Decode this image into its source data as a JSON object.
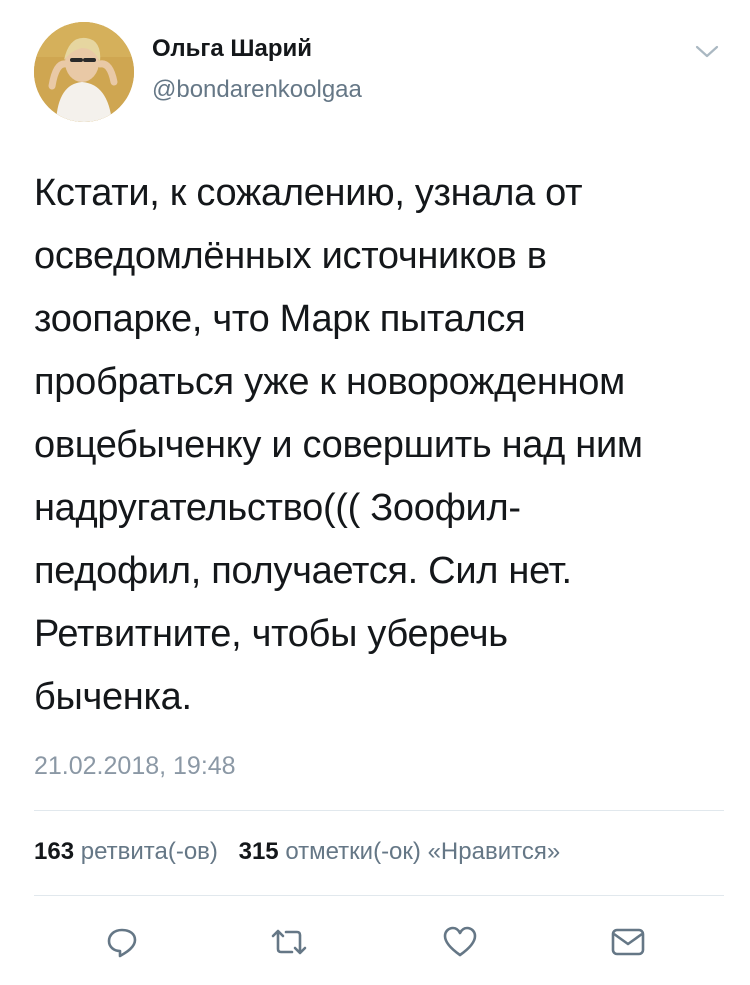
{
  "user": {
    "display_name": "Ольга Шарий",
    "handle": "@bondarenkoolgaa"
  },
  "tweet": {
    "text": "Кстати, к сожалению, узнала от\nосведомлённых источников в\nзоопарке, что Марк пытался\nпробраться уже к новорожденном\nовцебыченку и совершить над ним\nнадругательство((( Зоофил-\nпедофил, получается. Сил нет.\nРетвитните, чтобы уберечь\nбыченка.",
    "timestamp": "21.02.2018, 19:48"
  },
  "stats": {
    "retweets_count": "163",
    "retweets_label": "ретвита(-ов)",
    "likes_count": "315",
    "likes_label": "отметки(-ок) «Нравится»"
  },
  "icons": {
    "menu": "chevron-down-icon",
    "reply": "reply-icon",
    "retweet": "retweet-icon",
    "like": "heart-icon",
    "dm": "envelope-icon"
  },
  "colors": {
    "text": "#14171a",
    "secondary": "#657786",
    "timestamp": "#8b98a5",
    "divider": "#e1e8ed",
    "icon": "#657786"
  }
}
